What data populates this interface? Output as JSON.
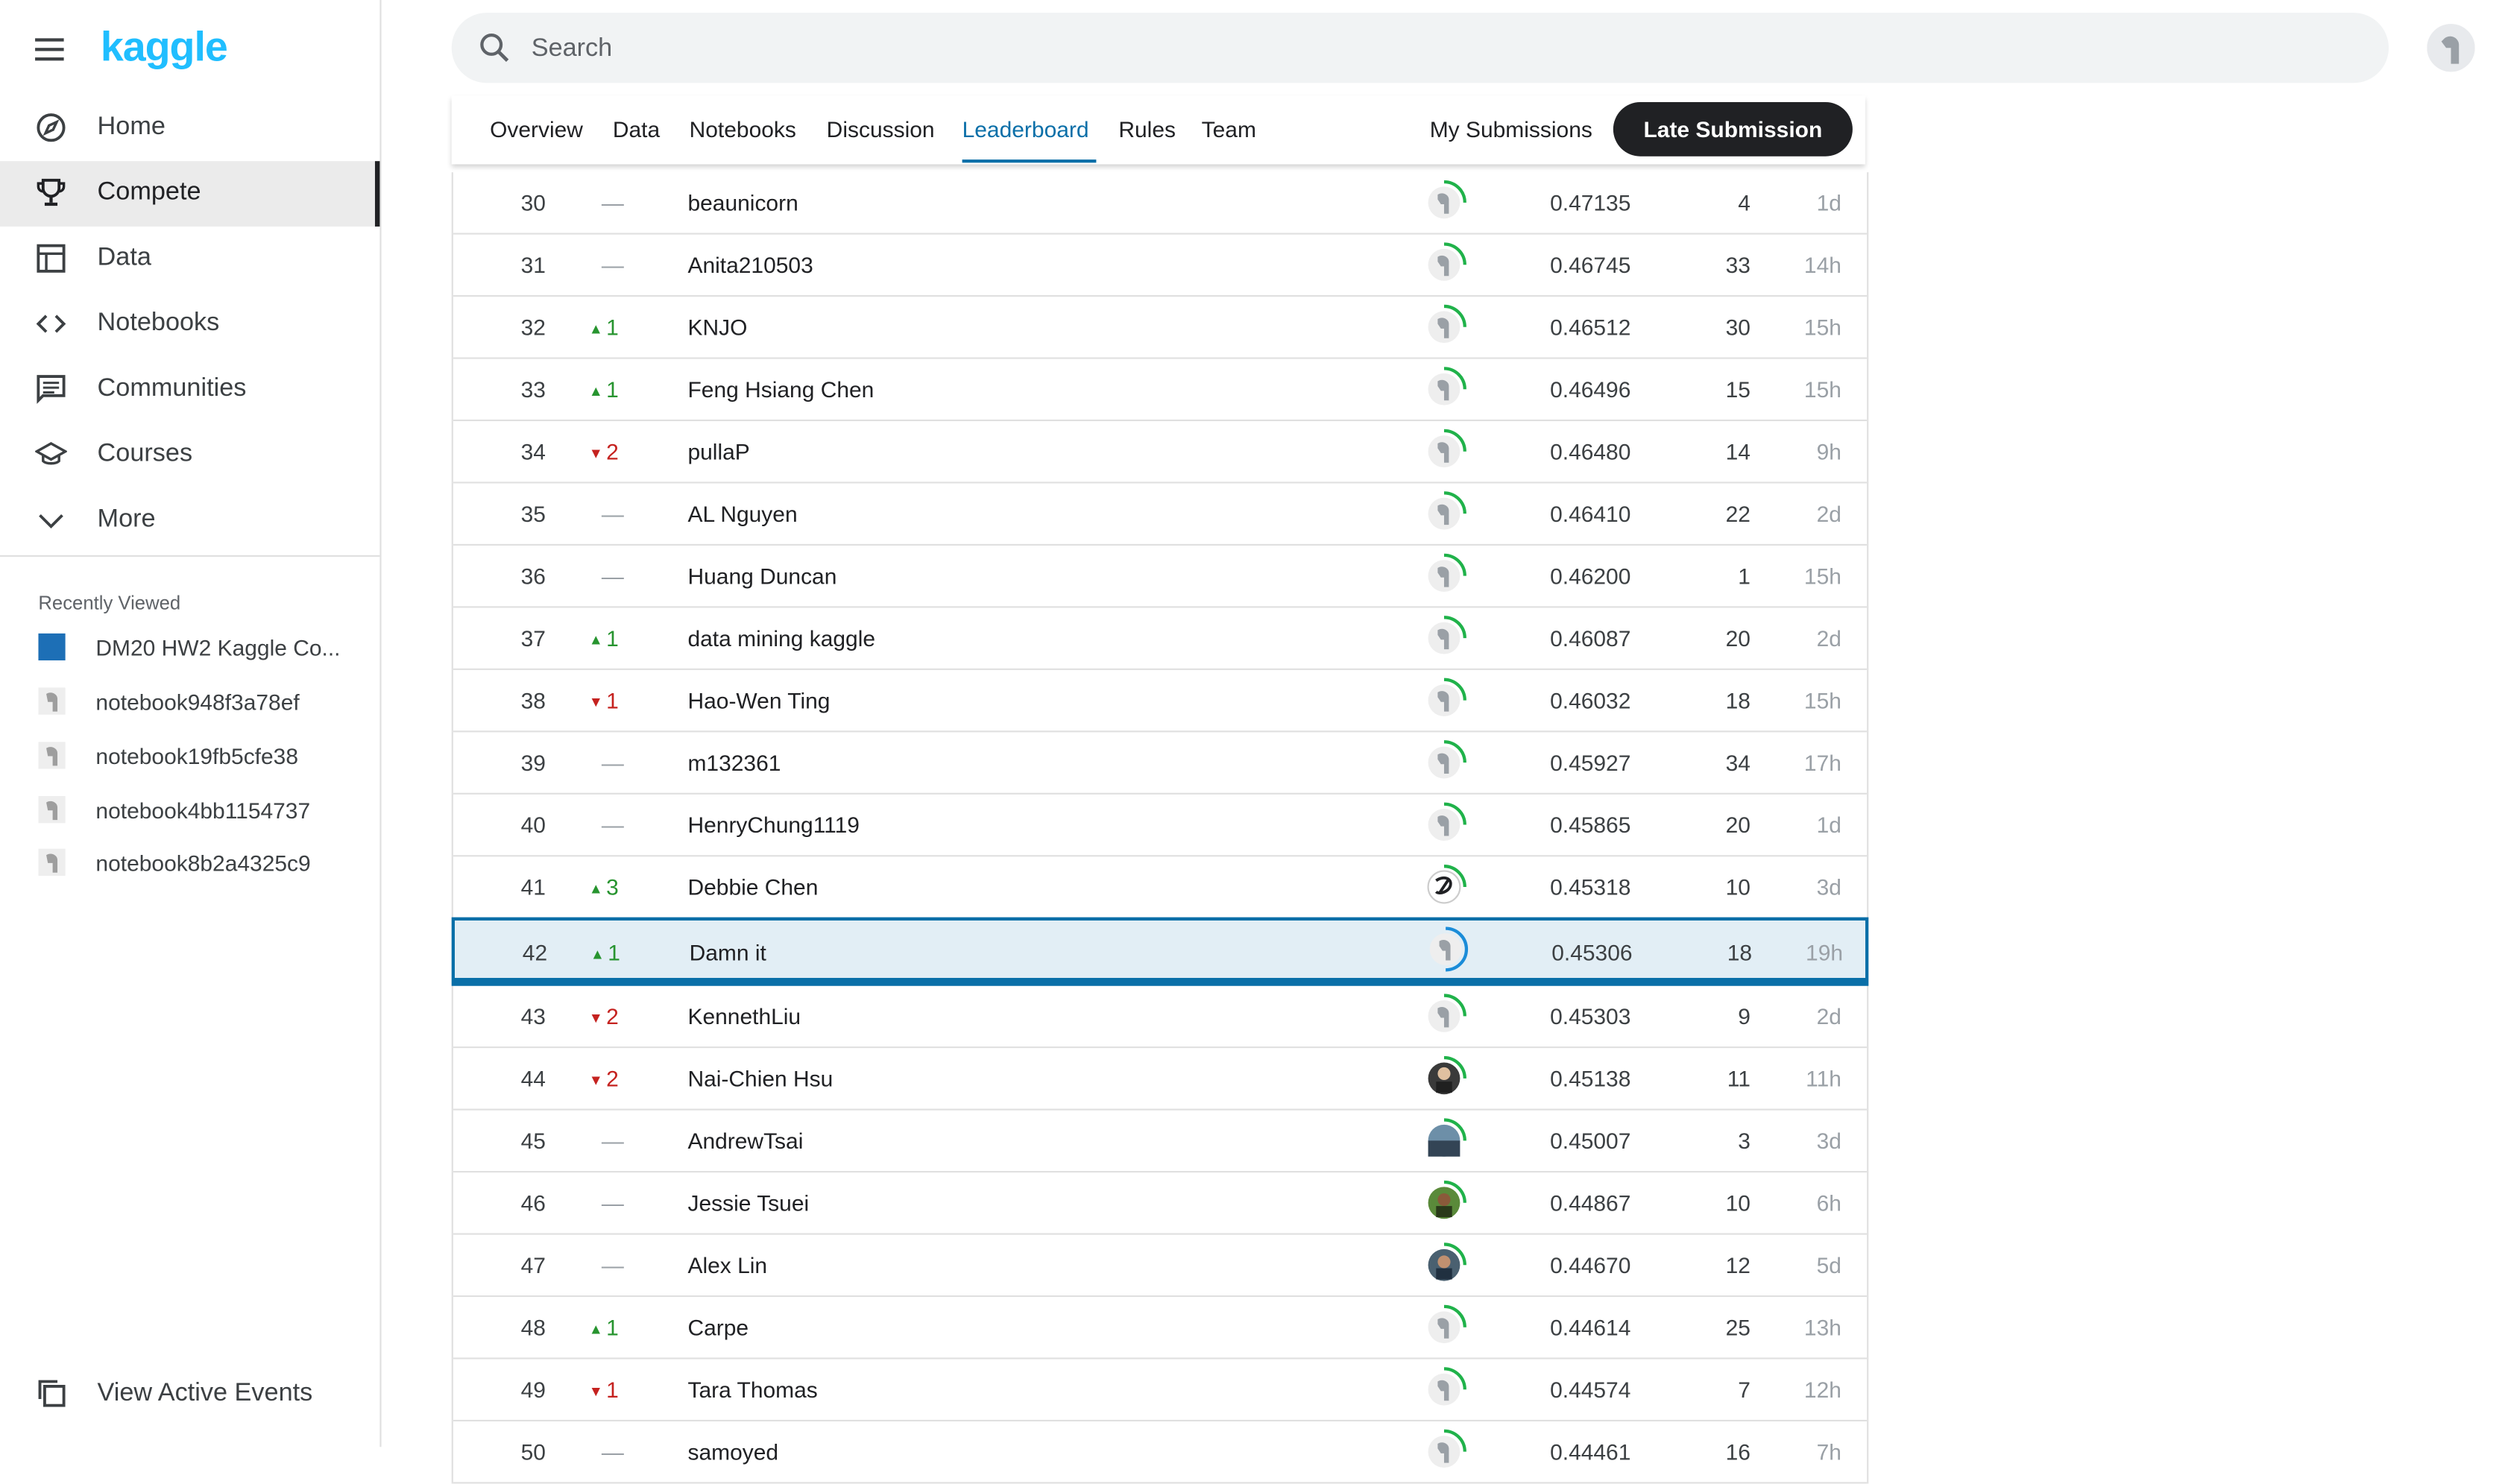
{
  "sidebar": {
    "logo": "kaggle",
    "nav": [
      {
        "label": "Home",
        "icon": "compass-icon",
        "active": false
      },
      {
        "label": "Compete",
        "icon": "trophy-icon",
        "active": true
      },
      {
        "label": "Data",
        "icon": "table-icon",
        "active": false
      },
      {
        "label": "Notebooks",
        "icon": "code-icon",
        "active": false
      },
      {
        "label": "Communities",
        "icon": "comments-icon",
        "active": false
      },
      {
        "label": "Courses",
        "icon": "school-icon",
        "active": false
      },
      {
        "label": "More",
        "icon": "chevron-down-icon",
        "active": false
      }
    ],
    "recently_viewed_title": "Recently Viewed",
    "recently_viewed": [
      {
        "label": "DM20 HW2 Kaggle Co...",
        "icon": "competition-thumbnail"
      },
      {
        "label": "notebook948f3a78ef",
        "icon": "notebook-avatar-icon"
      },
      {
        "label": "notebook19fb5cfe38",
        "icon": "notebook-avatar-icon"
      },
      {
        "label": "notebook4bb1154737",
        "icon": "notebook-avatar-icon"
      },
      {
        "label": "notebook8b2a4325c9",
        "icon": "notebook-avatar-icon"
      }
    ],
    "view_active_events": "View Active Events"
  },
  "search": {
    "placeholder": "Search",
    "value": ""
  },
  "tabs": [
    {
      "label": "Overview",
      "active": false
    },
    {
      "label": "Data",
      "active": false
    },
    {
      "label": "Notebooks",
      "active": false
    },
    {
      "label": "Discussion",
      "active": false
    },
    {
      "label": "Leaderboard",
      "active": true
    },
    {
      "label": "Rules",
      "active": false
    },
    {
      "label": "Team",
      "active": false
    }
  ],
  "my_submissions": "My Submissions",
  "late_submission": "Late Submission",
  "colors": {
    "accent": "#0a6fa8",
    "kaggle_blue": "#20beff",
    "up": "#27942f",
    "down": "#c5221f",
    "highlight_bg": "#e2eef5"
  },
  "leaderboard": [
    {
      "rank": "30",
      "dir": "none",
      "change": "—",
      "name": "beaunicorn",
      "avatar": "default",
      "score": "0.47135",
      "entries": "4",
      "last": "1d"
    },
    {
      "rank": "31",
      "dir": "none",
      "change": "—",
      "name": "Anita210503",
      "avatar": "default",
      "score": "0.46745",
      "entries": "33",
      "last": "14h"
    },
    {
      "rank": "32",
      "dir": "up",
      "change": "1",
      "name": "KNJO",
      "avatar": "default",
      "score": "0.46512",
      "entries": "30",
      "last": "15h"
    },
    {
      "rank": "33",
      "dir": "up",
      "change": "1",
      "name": "Feng Hsiang Chen",
      "avatar": "default",
      "score": "0.46496",
      "entries": "15",
      "last": "15h"
    },
    {
      "rank": "34",
      "dir": "down",
      "change": "2",
      "name": "pullaP",
      "avatar": "default",
      "score": "0.46480",
      "entries": "14",
      "last": "9h"
    },
    {
      "rank": "35",
      "dir": "none",
      "change": "—",
      "name": "AL Nguyen",
      "avatar": "default",
      "score": "0.46410",
      "entries": "22",
      "last": "2d"
    },
    {
      "rank": "36",
      "dir": "none",
      "change": "—",
      "name": "Huang Duncan",
      "avatar": "default",
      "score": "0.46200",
      "entries": "1",
      "last": "15h"
    },
    {
      "rank": "37",
      "dir": "up",
      "change": "1",
      "name": "data mining kaggle",
      "avatar": "default",
      "score": "0.46087",
      "entries": "20",
      "last": "2d"
    },
    {
      "rank": "38",
      "dir": "down",
      "change": "1",
      "name": "Hao-Wen Ting",
      "avatar": "default",
      "score": "0.46032",
      "entries": "18",
      "last": "15h"
    },
    {
      "rank": "39",
      "dir": "none",
      "change": "—",
      "name": "m132361",
      "avatar": "default",
      "score": "0.45927",
      "entries": "34",
      "last": "17h"
    },
    {
      "rank": "40",
      "dir": "none",
      "change": "—",
      "name": "HenryChung1119",
      "avatar": "default",
      "score": "0.45865",
      "entries": "20",
      "last": "1d"
    },
    {
      "rank": "41",
      "dir": "up",
      "change": "3",
      "name": "Debbie Chen",
      "avatar": "logo",
      "score": "0.45318",
      "entries": "10",
      "last": "3d"
    },
    {
      "rank": "42",
      "dir": "up",
      "change": "1",
      "name": "Damn it",
      "avatar": "default",
      "score": "0.45306",
      "entries": "18",
      "last": "19h",
      "me": true
    },
    {
      "rank": "43",
      "dir": "down",
      "change": "2",
      "name": "KennethLiu",
      "avatar": "default",
      "score": "0.45303",
      "entries": "9",
      "last": "2d"
    },
    {
      "rank": "44",
      "dir": "down",
      "change": "2",
      "name": "Nai-Chien Hsu",
      "avatar": "photo-dark",
      "score": "0.45138",
      "entries": "11",
      "last": "11h"
    },
    {
      "rank": "45",
      "dir": "none",
      "change": "—",
      "name": "AndrewTsai",
      "avatar": "photo-sea",
      "score": "0.45007",
      "entries": "3",
      "last": "3d"
    },
    {
      "rank": "46",
      "dir": "none",
      "change": "—",
      "name": "Jessie Tsuei",
      "avatar": "photo-green",
      "score": "0.44867",
      "entries": "10",
      "last": "6h"
    },
    {
      "rank": "47",
      "dir": "none",
      "change": "—",
      "name": "Alex Lin",
      "avatar": "photo-person",
      "score": "0.44670",
      "entries": "12",
      "last": "5d"
    },
    {
      "rank": "48",
      "dir": "up",
      "change": "1",
      "name": "Carpe",
      "avatar": "default",
      "score": "0.44614",
      "entries": "25",
      "last": "13h"
    },
    {
      "rank": "49",
      "dir": "down",
      "change": "1",
      "name": "Tara Thomas",
      "avatar": "default",
      "score": "0.44574",
      "entries": "7",
      "last": "12h"
    },
    {
      "rank": "50",
      "dir": "none",
      "change": "—",
      "name": "samoyed",
      "avatar": "default",
      "score": "0.44461",
      "entries": "16",
      "last": "7h"
    }
  ]
}
